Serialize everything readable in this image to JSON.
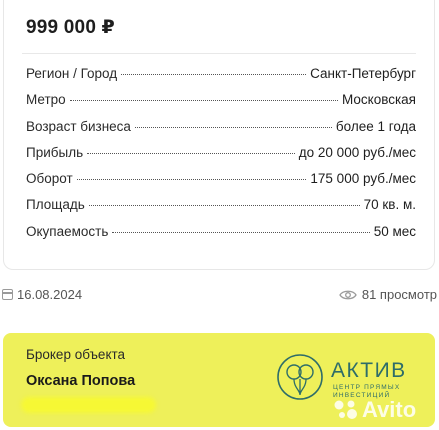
{
  "listing": {
    "price": "999 000 ₽",
    "params": [
      {
        "label": "Регион / Город",
        "value": "Санкт-Петербург"
      },
      {
        "label": "Метро",
        "value": "Московская"
      },
      {
        "label": "Возраст бизнеса",
        "value": "более 1 года"
      },
      {
        "label": "Прибыль",
        "value": "до 20 000 руб./мес"
      },
      {
        "label": "Оборот",
        "value": "175 000 руб./мес"
      },
      {
        "label": "Площадь",
        "value": "70 кв. м."
      },
      {
        "label": "Окупаемость",
        "value": "50 мес"
      }
    ]
  },
  "meta": {
    "date": "16.08.2024",
    "views": "81 просмотр",
    "date_icon": "calendar-icon",
    "views_icon": "eye-icon"
  },
  "broker": {
    "title": "Брокер объекта",
    "name": "Оксана Попова",
    "company": "АКТИВ",
    "company_sub": "центр прямых инвестиций",
    "watermark": "Avito",
    "background": "#eef05a",
    "brand_color": "#2e6d69"
  }
}
